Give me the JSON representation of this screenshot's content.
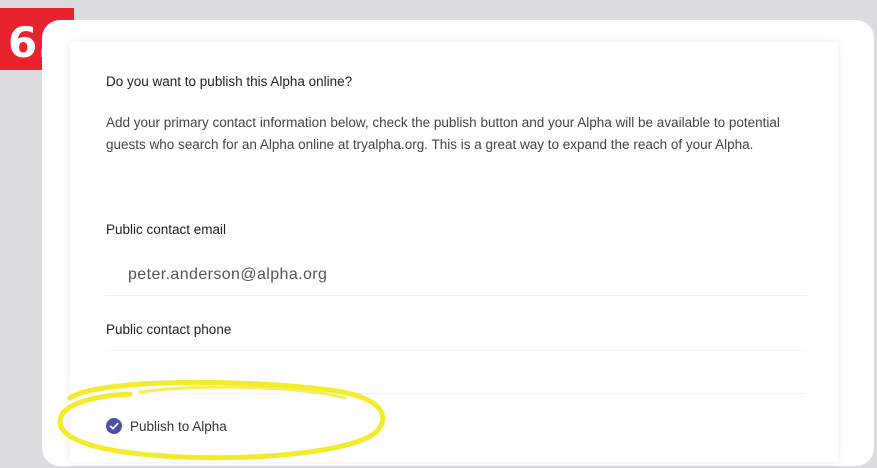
{
  "step": {
    "number": "6."
  },
  "form": {
    "question": "Do you want to publish this Alpha online?",
    "description": "Add your primary contact information below, check the publish button and your Alpha will be available to potential guests who search for an Alpha online at tryalpha.org. This is a great way to expand the reach of your Alpha.",
    "email_label": "Public contact email",
    "email_value": "peter.anderson@alpha.org",
    "phone_label": "Public contact phone",
    "phone_value": "",
    "publish_label": "Publish to Alpha",
    "publish_checked": true
  },
  "colors": {
    "badge": "#e8232f",
    "checkbox": "#4b4fa8",
    "highlight": "#f2ea2a"
  },
  "icons": {
    "checkbox": "check-circle-icon"
  }
}
